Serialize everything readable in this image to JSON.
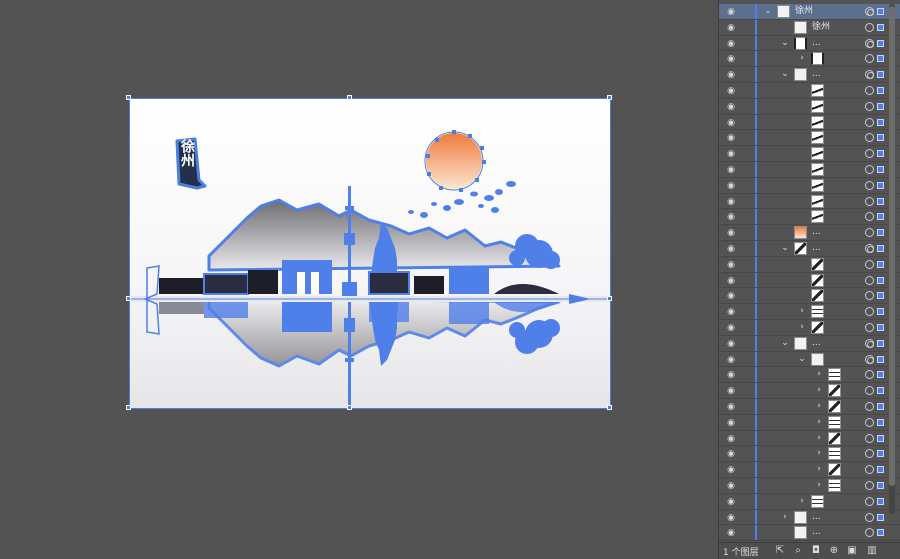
{
  "artboard": {
    "sign_text": "徐州"
  },
  "colors": {
    "selection": "#4a7fe0",
    "sun_top": "#f07b3c",
    "sun_bottom": "#fbe6d2",
    "panel_bg": "#535353",
    "selected_row": "#5c6f8c"
  },
  "layers": [
    {
      "name": "徐州",
      "level": 0,
      "twirl": "down",
      "thumb": "white",
      "selected": true
    },
    {
      "name": "徐州",
      "level": 1,
      "twirl": "none",
      "thumb": "white"
    },
    {
      "name": "...",
      "level": 1,
      "twirl": "down",
      "thumb": "bracket"
    },
    {
      "name": "",
      "level": 2,
      "twirl": "right",
      "thumb": "bracket"
    },
    {
      "name": "...",
      "level": 1,
      "twirl": "down",
      "thumb": "white"
    },
    {
      "name": "",
      "level": 2,
      "twirl": "none",
      "thumb": "stroke"
    },
    {
      "name": "",
      "level": 2,
      "twirl": "none",
      "thumb": "stroke"
    },
    {
      "name": "",
      "level": 2,
      "twirl": "none",
      "thumb": "stroke"
    },
    {
      "name": "",
      "level": 2,
      "twirl": "none",
      "thumb": "stroke"
    },
    {
      "name": "",
      "level": 2,
      "twirl": "none",
      "thumb": "stroke"
    },
    {
      "name": "",
      "level": 2,
      "twirl": "none",
      "thumb": "stroke"
    },
    {
      "name": "",
      "level": 2,
      "twirl": "none",
      "thumb": "stroke"
    },
    {
      "name": "",
      "level": 2,
      "twirl": "none",
      "thumb": "stroke"
    },
    {
      "name": "",
      "level": 2,
      "twirl": "none",
      "thumb": "stroke"
    },
    {
      "name": "...",
      "level": 1,
      "twirl": "none",
      "thumb": "sun"
    },
    {
      "name": "...",
      "level": 1,
      "twirl": "down",
      "thumb": "dark"
    },
    {
      "name": "",
      "level": 2,
      "twirl": "none",
      "thumb": "dark"
    },
    {
      "name": "",
      "level": 2,
      "twirl": "none",
      "thumb": "dark"
    },
    {
      "name": "",
      "level": 2,
      "twirl": "none",
      "thumb": "dark"
    },
    {
      "name": "",
      "level": 2,
      "twirl": "right",
      "thumb": "lines"
    },
    {
      "name": "",
      "level": 2,
      "twirl": "right",
      "thumb": "dark"
    },
    {
      "name": "...",
      "level": 1,
      "twirl": "down",
      "thumb": "white"
    },
    {
      "name": "",
      "level": 2,
      "twirl": "down",
      "thumb": "white"
    },
    {
      "name": "",
      "level": 3,
      "twirl": "right",
      "thumb": "lines"
    },
    {
      "name": "",
      "level": 3,
      "twirl": "right",
      "thumb": "dark"
    },
    {
      "name": "",
      "level": 3,
      "twirl": "right",
      "thumb": "dark"
    },
    {
      "name": "",
      "level": 3,
      "twirl": "right",
      "thumb": "lines"
    },
    {
      "name": "",
      "level": 3,
      "twirl": "right",
      "thumb": "dark"
    },
    {
      "name": "",
      "level": 3,
      "twirl": "right",
      "thumb": "lines"
    },
    {
      "name": "",
      "level": 3,
      "twirl": "right",
      "thumb": "dark"
    },
    {
      "name": "",
      "level": 3,
      "twirl": "right",
      "thumb": "lines"
    },
    {
      "name": "",
      "level": 2,
      "twirl": "right",
      "thumb": "lines"
    },
    {
      "name": "...",
      "level": 1,
      "twirl": "right",
      "thumb": "white"
    },
    {
      "name": "...",
      "level": 1,
      "twirl": "none",
      "thumb": "white"
    }
  ],
  "footer": {
    "layer_count": "1 个图层"
  }
}
